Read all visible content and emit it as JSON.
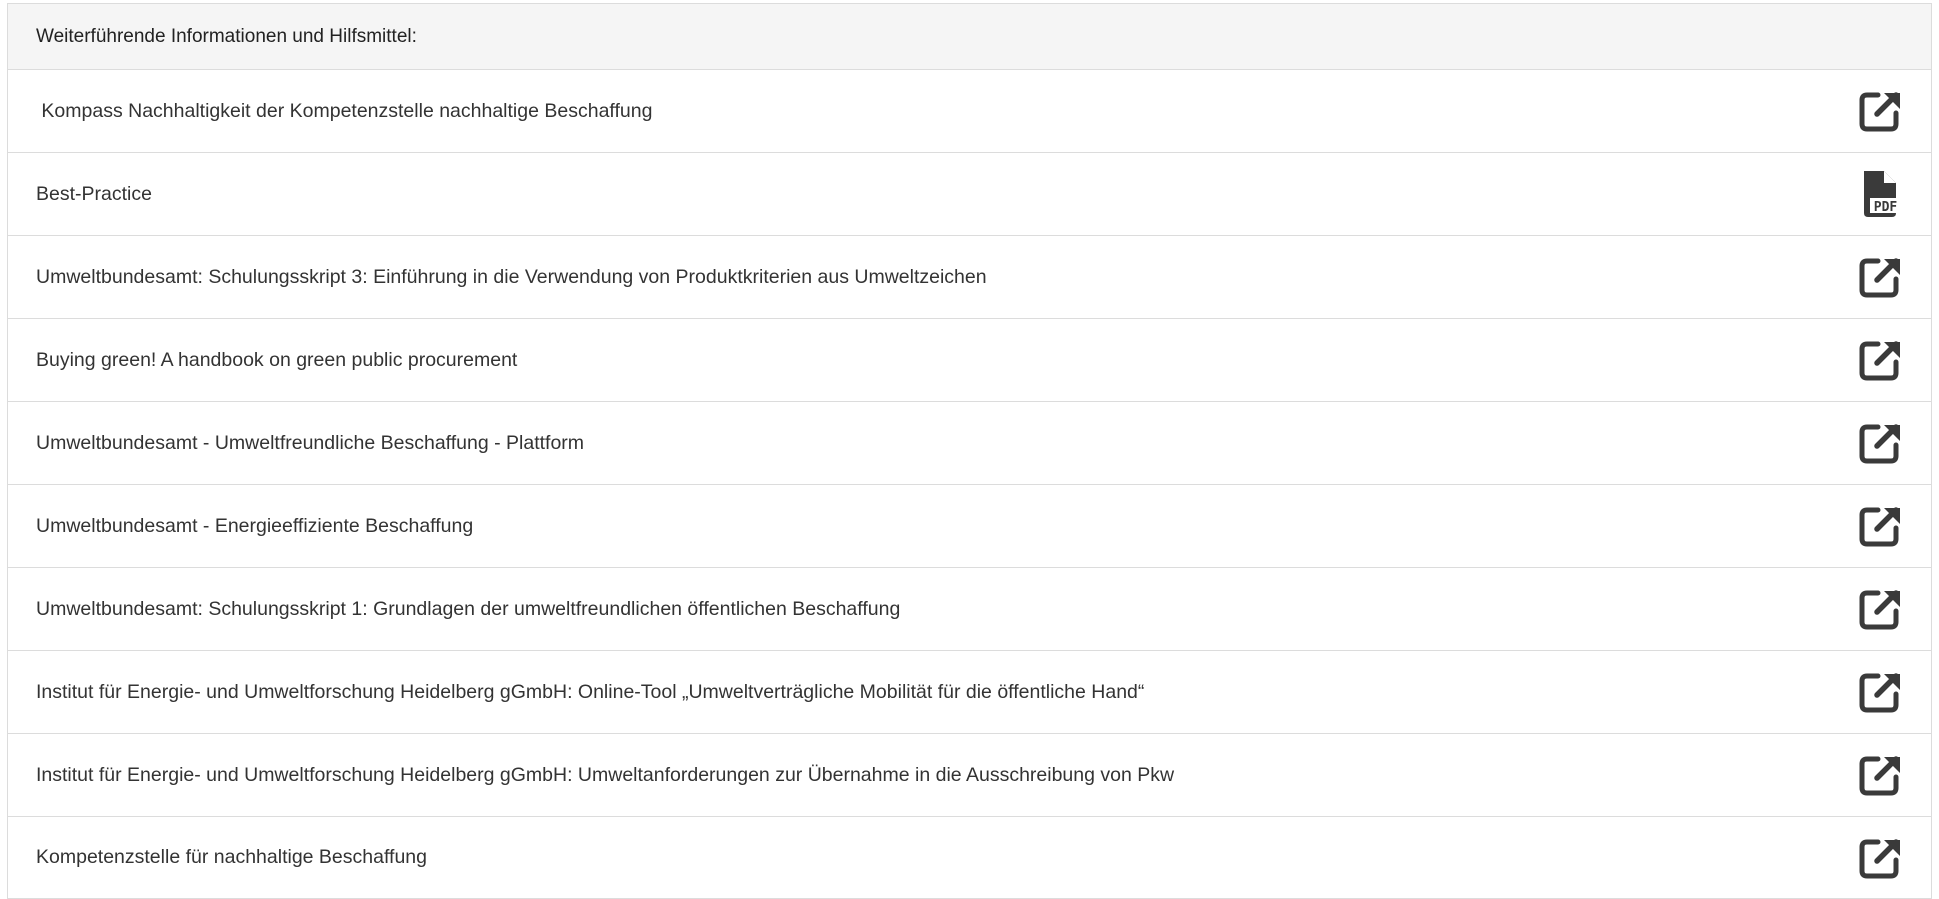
{
  "panel": {
    "title": "Weiterführende Informationen und Hilfsmittel:"
  },
  "colors": {
    "icon": "#3a3a3a",
    "border": "#dcdcdc",
    "header_bg": "#f5f5f5"
  },
  "items": [
    {
      "label": " Kompass Nachhaltigkeit der Kompetenzstelle nachhaltige Beschaffung",
      "icon": "external-link-icon"
    },
    {
      "label": "Best-Practice",
      "icon": "pdf-file-icon",
      "pdf_text": "PDF"
    },
    {
      "label": "Umweltbundesamt: Schulungsskript 3: Einführung in die Verwendung von Produktkriterien aus Umweltzeichen",
      "icon": "external-link-icon"
    },
    {
      "label": "Buying green! A handbook on green public procurement",
      "icon": "external-link-icon"
    },
    {
      "label": "Umweltbundesamt - Umweltfreundliche Beschaffung - Plattform",
      "icon": "external-link-icon"
    },
    {
      "label": "Umweltbundesamt - Energieeffiziente Beschaffung",
      "icon": "external-link-icon"
    },
    {
      "label": "Umweltbundesamt: Schulungsskript 1: Grundlagen der umweltfreundlichen öffentlichen Beschaffung",
      "icon": "external-link-icon"
    },
    {
      "label": "Institut für Energie- und Umweltforschung Heidelberg gGmbH: Online-Tool „Umweltverträgliche Mobilität für die öffentliche Hand“",
      "icon": "external-link-icon"
    },
    {
      "label": "Institut für Energie- und Umweltforschung Heidelberg gGmbH: Umweltanforderungen zur Übernahme in die Ausschreibung von Pkw",
      "icon": "external-link-icon"
    },
    {
      "label": "Kompetenzstelle für nachhaltige Beschaffung",
      "icon": "external-link-icon"
    }
  ]
}
